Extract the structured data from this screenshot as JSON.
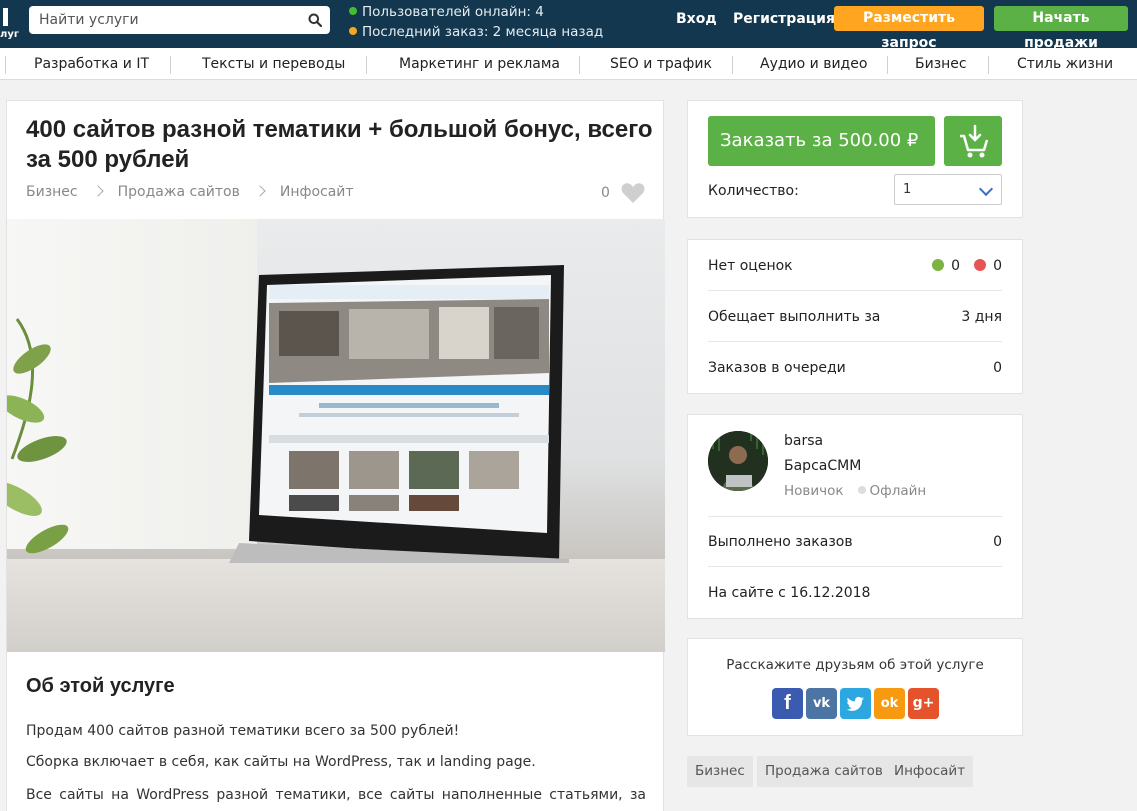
{
  "header": {
    "logo_fragment": "луг",
    "search_placeholder": "Найти услуги",
    "online_users": "Пользователей онлайн: 4",
    "last_order": "Последний заказ: 2 месяца назад",
    "online_dot_color": "#3fbf2c",
    "order_dot_color": "#f5a623",
    "login": "Вход",
    "register": "Регистрация",
    "post_request": "Разместить запрос",
    "start_selling": "Начать продажи"
  },
  "categories": [
    "Разработка и IT",
    "Тексты и переводы",
    "Маркетинг и реклама",
    "SEO и трафик",
    "Аудио и видео",
    "Бизнес",
    "Стиль жизни"
  ],
  "listing": {
    "title": "400 сайтов разной тематики + большой бонус, всего за 500 рублей",
    "breadcrumbs": [
      "Бизнес",
      "Продажа сайтов",
      "Инфосайт"
    ],
    "favorites_count": "0",
    "about_title": "Об этой услуге",
    "paragraphs": [
      "Продам 400 сайтов разной тематики всего за 500 рублей!",
      "Сборка включает в себя, как сайты на WordPress, так и landing page.",
      "Все сайты на WordPress разной тематики, все сайты наполненные статьями, за"
    ]
  },
  "order": {
    "button_label": "Заказать за 500.00 ₽",
    "quantity_label": "Количество:",
    "quantity_value": "1",
    "accent_color": "#5bb146"
  },
  "stats": {
    "rating_label": "Нет оценок",
    "positive_count": "0",
    "negative_count": "0",
    "positive_color": "#7cb342",
    "negative_color": "#e55353",
    "deadline_label": "Обещает выполнить за",
    "deadline_value": "3 дня",
    "queue_label": "Заказов в очереди",
    "queue_value": "0"
  },
  "seller": {
    "login": "barsa",
    "name": "БарсаСММ",
    "level": "Новичок",
    "status": "Офлайн",
    "completed_label": "Выполнено заказов",
    "completed_value": "0",
    "since": "На сайте с 16.12.2018"
  },
  "share": {
    "title": "Расскажите друзьям об этой услуге",
    "networks": [
      {
        "icon": "facebook-icon",
        "glyph": "f",
        "color": "#3b5bb0"
      },
      {
        "icon": "vk-icon",
        "glyph": "vk",
        "color": "#4c75a3"
      },
      {
        "icon": "twitter-icon",
        "glyph": "t",
        "color": "#2ca7e0"
      },
      {
        "icon": "odnoklassniki-icon",
        "glyph": "ok",
        "color": "#f79a0f"
      },
      {
        "icon": "google-plus-icon",
        "glyph": "g+",
        "color": "#e5532c"
      }
    ]
  },
  "tags": [
    "Бизнес",
    "Продажа сайтов",
    "Инфосайт"
  ]
}
